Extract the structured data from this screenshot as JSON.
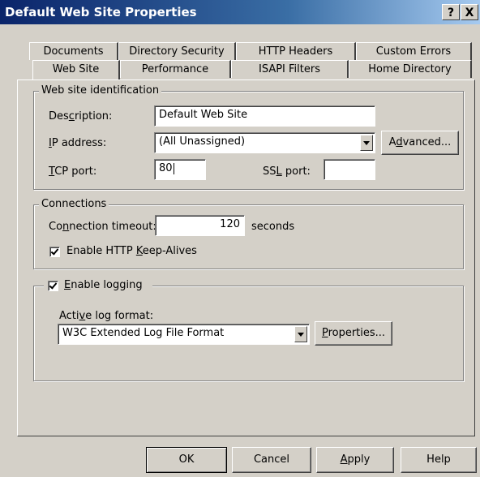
{
  "window": {
    "title": "Default Web Site Properties"
  },
  "titlebar_buttons": {
    "help": "?",
    "close": "X"
  },
  "tabs": {
    "row_back": [
      "Documents",
      "Directory Security",
      "HTTP Headers",
      "Custom Errors"
    ],
    "row_front": [
      "Web Site",
      "Performance",
      "ISAPI Filters",
      "Home Directory"
    ],
    "active": "Web Site"
  },
  "identification": {
    "legend": "Web site identification",
    "description_label": [
      "Des",
      "c",
      "ription:"
    ],
    "description_value": "Default Web Site",
    "ip_label": [
      "",
      "I",
      "P address:"
    ],
    "ip_value": "(All Unassigned)",
    "advanced_label": [
      "A",
      "d",
      "vanced..."
    ],
    "tcp_label": [
      "",
      "T",
      "CP port:"
    ],
    "tcp_value": "80",
    "ssl_label": [
      "SS",
      "L",
      " port:"
    ],
    "ssl_value": ""
  },
  "connections": {
    "legend": "Connections",
    "timeout_label": [
      "Co",
      "n",
      "nection timeout:"
    ],
    "timeout_value": "120",
    "timeout_unit": "seconds",
    "keepalive_label": [
      "Enable HTTP ",
      "K",
      "eep-Alives"
    ],
    "keepalive_checked": true
  },
  "logging": {
    "enable_label": [
      "",
      "E",
      "nable logging"
    ],
    "enable_checked": true,
    "format_label": [
      "Acti",
      "v",
      "e log format:"
    ],
    "format_value": "W3C Extended Log File Format",
    "properties_label": [
      "",
      "P",
      "roperties..."
    ]
  },
  "buttons": {
    "ok": "OK",
    "cancel": "Cancel",
    "apply": [
      "",
      "A",
      "pply"
    ],
    "help": "Help"
  }
}
